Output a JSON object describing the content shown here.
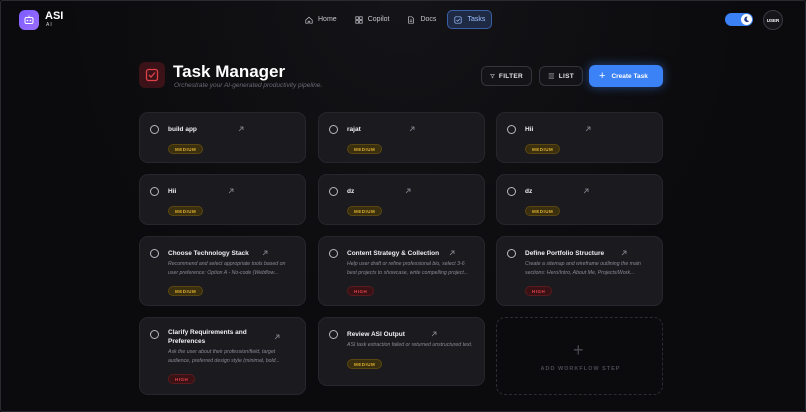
{
  "app": {
    "name": "ASI",
    "sub": "AI"
  },
  "nav": [
    {
      "label": "Home",
      "icon": "home-icon",
      "active": false
    },
    {
      "label": "Copilot",
      "icon": "grid-icon",
      "active": false
    },
    {
      "label": "Docs",
      "icon": "document-icon",
      "active": false
    },
    {
      "label": "Tasks",
      "icon": "checkbox-icon",
      "active": true
    }
  ],
  "user": {
    "label": "USER"
  },
  "header": {
    "title": "Task Manager",
    "subtitle": "Orchestrate your AI-generated productivity pipeline.",
    "filter_label": "FILTER",
    "list_label": "LIST",
    "create_label": "Create Task"
  },
  "tasks": [
    {
      "title": "build app",
      "desc": "",
      "priority": "MEDIUM"
    },
    {
      "title": "rajat",
      "desc": "",
      "priority": "MEDIUM"
    },
    {
      "title": "Hii",
      "desc": "",
      "priority": "MEDIUM"
    },
    {
      "title": "Hii",
      "desc": "",
      "priority": "MEDIUM"
    },
    {
      "title": "dz",
      "desc": "",
      "priority": "MEDIUM"
    },
    {
      "title": "dz",
      "desc": "",
      "priority": "MEDIUM"
    },
    {
      "title": "Choose Technology Stack",
      "desc": "Recommend and select appropriate tools based on user preference: Option A - No-code (Webflow...",
      "priority": "MEDIUM"
    },
    {
      "title": "Content Strategy & Collection",
      "desc": "Help user draft or refine professional bio, select 3-6 best projects to showcase, write compelling project...",
      "priority": "HIGH"
    },
    {
      "title": "Define Portfolio Structure",
      "desc": "Create a sitemap and wireframe outlining the main sections: Hero/Intro, About Me, Projects/Work...",
      "priority": "HIGH"
    },
    {
      "title": "Clarify Requirements and Preferences",
      "desc": "Ask the user about their profession/field, target audience, preferred design style (minimal, bold...",
      "priority": "HIGH"
    },
    {
      "title": "Review ASI Output",
      "desc": "ASI task extraction failed or returned unstructured text.",
      "priority": "MEDIUM"
    }
  ],
  "add_step": {
    "plus": "+",
    "label": "ADD WORKFLOW STEP"
  },
  "colors": {
    "accent": "#3b82f6",
    "medium": "#e0b030",
    "high": "#e0404a",
    "brand": "#7b5cff"
  }
}
